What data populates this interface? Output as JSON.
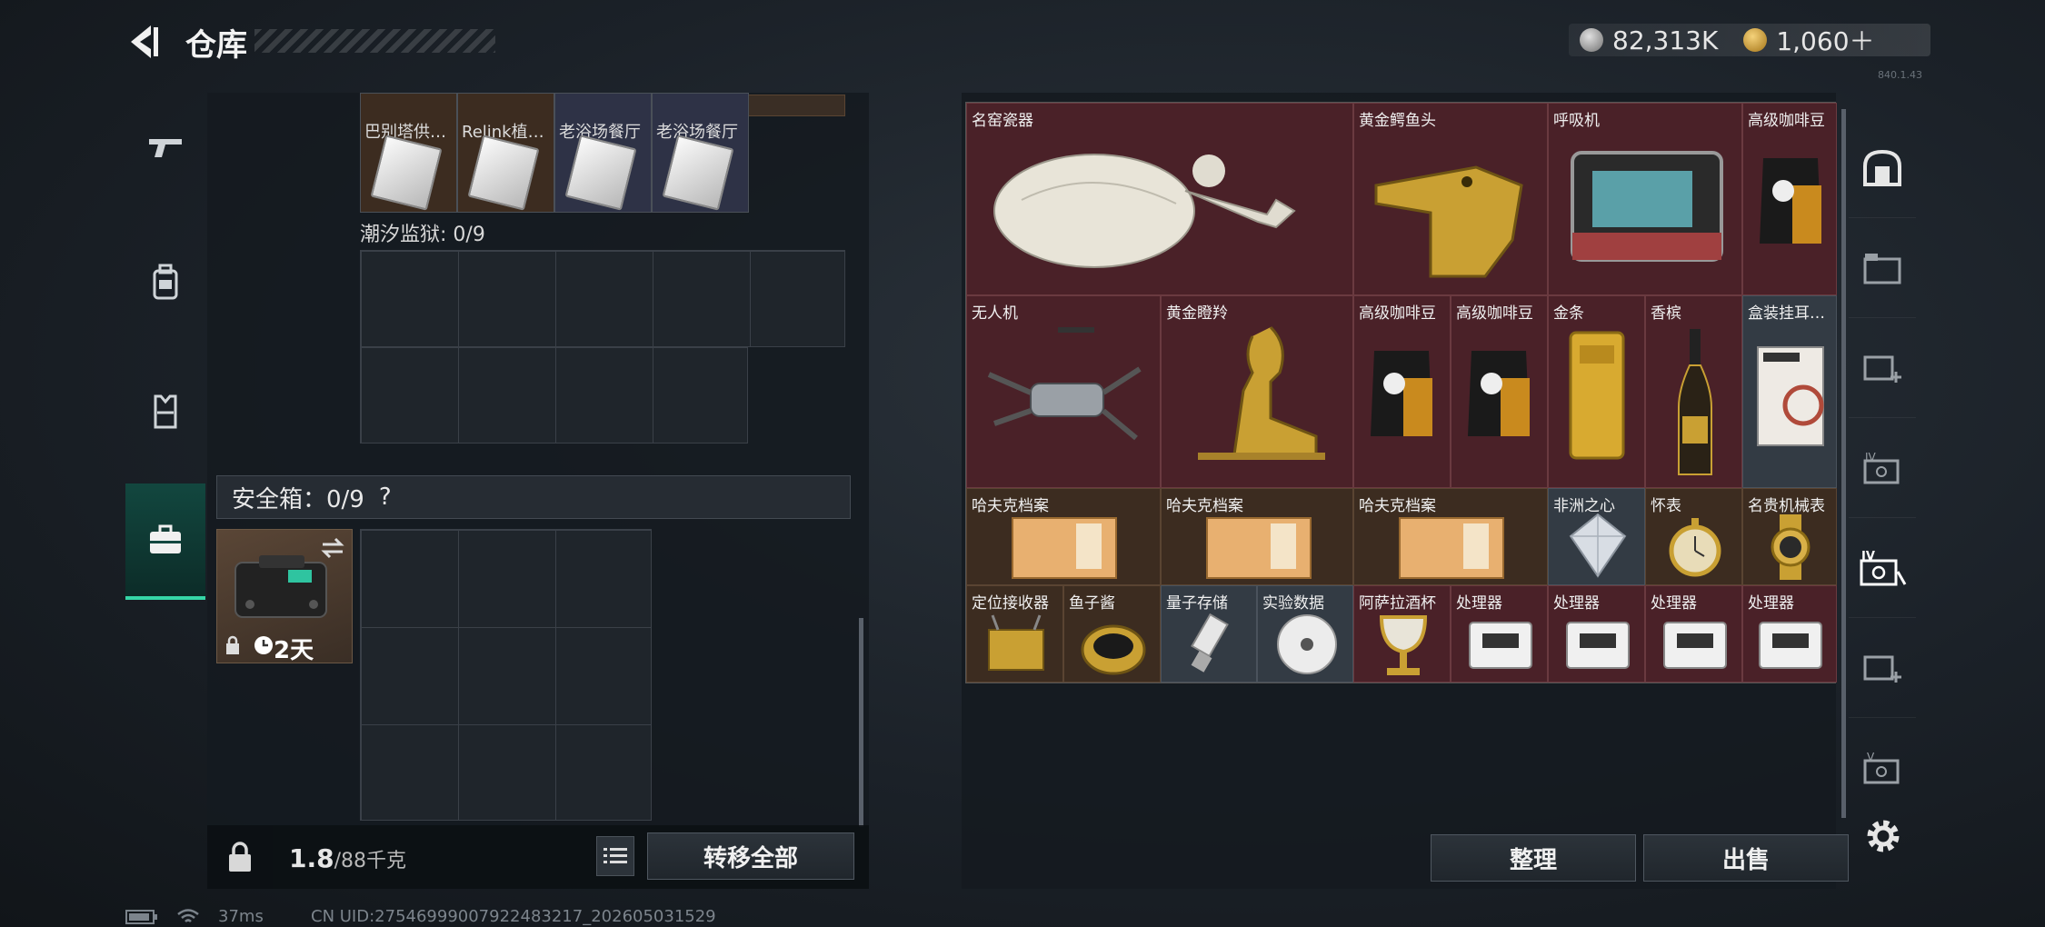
{
  "header": {
    "title": "仓库",
    "currency": [
      {
        "value": "82,313K",
        "icon": "silver-coin-icon"
      },
      {
        "value": "1,060＋",
        "icon": "gold-coin-icon"
      }
    ],
    "build": "840.1.43"
  },
  "left_nav": [
    "gun-icon",
    "backpack-icon",
    "vest-icon",
    "briefcase-icon"
  ],
  "stash_items": [
    {
      "label": "巴别塔供…"
    },
    {
      "label": "Relink植…"
    },
    {
      "label": "老浴场餐厅"
    },
    {
      "label": "老浴场餐厅"
    }
  ],
  "prison": {
    "label": "潮汐监狱: 0/9"
  },
  "safe": {
    "label": "安全箱：0/9",
    "help": "?",
    "duration": "2天"
  },
  "footer_left": {
    "weight": "1.8",
    "capacity": "/88千克",
    "transfer_all": "转移全部"
  },
  "items": [
    {
      "name": "名窑瓷器",
      "icon": "vase-icon"
    },
    {
      "name": "黄金鳄鱼头",
      "icon": "gold-crocodile-head-icon"
    },
    {
      "name": "呼吸机",
      "icon": "ventilator-icon"
    },
    {
      "name": "高级咖啡豆",
      "icon": "coffee-bag-icon"
    },
    {
      "name": "无人机",
      "icon": "drone-icon"
    },
    {
      "name": "黄金瞪羚",
      "icon": "gold-gazelle-icon"
    },
    {
      "name": "高级咖啡豆",
      "icon": "coffee-bag-icon"
    },
    {
      "name": "高级咖啡豆",
      "icon": "coffee-bag-icon"
    },
    {
      "name": "金条",
      "icon": "gold-bar-icon"
    },
    {
      "name": "香槟",
      "icon": "champagne-icon"
    },
    {
      "name": "盒装挂耳…",
      "icon": "coffee-box-icon"
    },
    {
      "name": "哈夫克档案",
      "icon": "archive-icon"
    },
    {
      "name": "哈夫克档案",
      "icon": "archive-icon"
    },
    {
      "name": "哈夫克档案",
      "icon": "archive-icon"
    },
    {
      "name": "非洲之心",
      "icon": "diamond-icon"
    },
    {
      "name": "怀表",
      "icon": "pocket-watch-icon"
    },
    {
      "name": "名贵机械表",
      "icon": "wristwatch-icon"
    },
    {
      "name": "定位接收器",
      "icon": "receiver-icon"
    },
    {
      "name": "鱼子酱",
      "icon": "caviar-icon"
    },
    {
      "name": "量子存储",
      "icon": "usb-drive-icon"
    },
    {
      "name": "实验数据",
      "icon": "disc-icon"
    },
    {
      "name": "阿萨拉酒杯",
      "icon": "goblet-icon"
    },
    {
      "name": "处理器",
      "icon": "processor-icon"
    },
    {
      "name": "处理器",
      "icon": "processor-icon"
    },
    {
      "name": "处理器",
      "icon": "processor-icon"
    },
    {
      "name": "处理器",
      "icon": "processor-icon"
    }
  ],
  "footer_right": {
    "organize": "整理",
    "sell": "出售"
  },
  "status": {
    "ping": "37ms",
    "uid": "CN UID:27546999007922483217_202605031529"
  }
}
